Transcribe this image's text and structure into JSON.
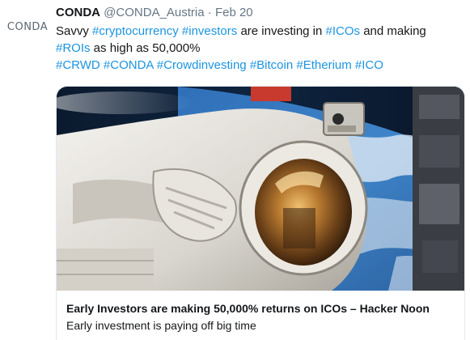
{
  "avatar": {
    "logo_text": "CONDA"
  },
  "tweet": {
    "display_name": "CONDA",
    "handle": "@CONDA_Austria",
    "separator": "·",
    "date": "Feb 20",
    "text": {
      "part1": "Savvy ",
      "tag1": "#cryptocurrency",
      "part2": " ",
      "tag2": "#investors",
      "part3": " are investing in ",
      "tag3": "#ICOs",
      "part4": " and making ",
      "tag4": "#ROIs",
      "part5": " as high as 50,000%"
    },
    "hashtags": [
      "#CRWD",
      "#CONDA",
      "#Crowdinvesting",
      "#Bitcoin",
      "#Etherium",
      "#ICO"
    ]
  },
  "card": {
    "image_icon": "astronaut-photo",
    "title": "Early Investors are making 50,000% returns on ICOs – Hacker Noon",
    "description": "Early investment is paying off big time"
  },
  "colors": {
    "hashtag": "#1b95e0",
    "text": "#14171a",
    "muted": "#657786",
    "border": "#e1e8ed"
  }
}
